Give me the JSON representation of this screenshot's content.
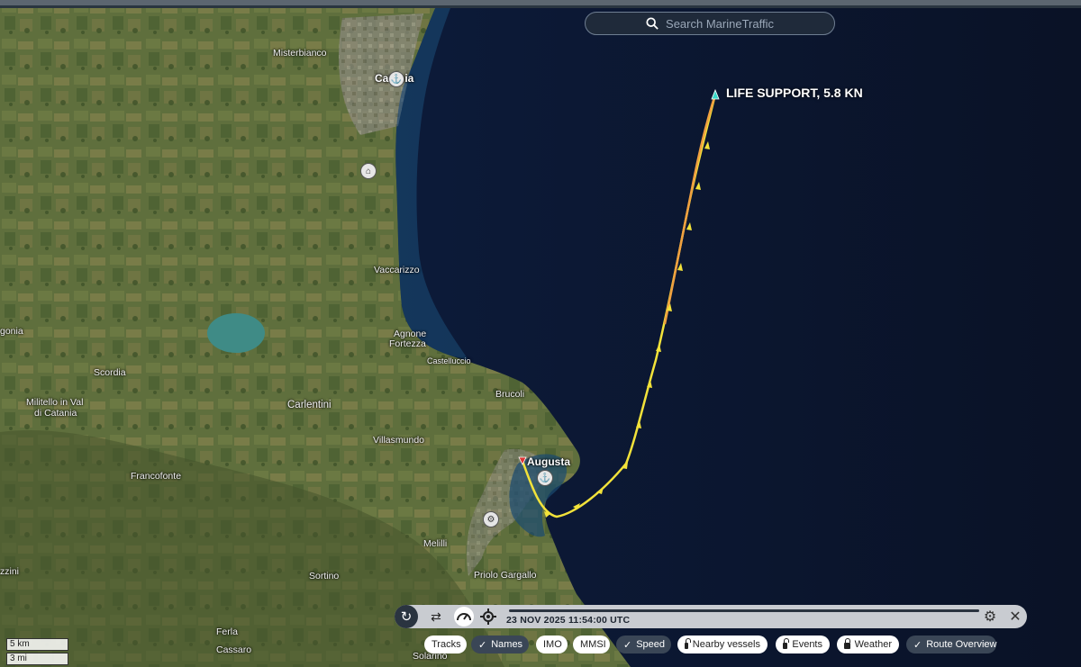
{
  "search": {
    "placeholder": "Search MarineTraffic"
  },
  "vessel": {
    "label": "LIFE SUPPORT, 5.8 KN"
  },
  "places": {
    "misterbianco": "Misterbianco",
    "catania": "Catania",
    "vaccarizzo": "Vaccarizzo",
    "agnone": "Agnone",
    "fortezza": "Fortezza",
    "castelluccio": "Castelluccio",
    "brucoli": "Brucoli",
    "augusta": "Augusta",
    "carlentini": "Carlentini",
    "villasmundo": "Villasmundo",
    "scordia": "Scordia",
    "militello1": "Militello in Val",
    "militello2": "di Catania",
    "francofonte": "Francofonte",
    "melilli": "Melilli",
    "sortino": "Sortino",
    "priolo": "Priolo Gargallo",
    "ferla": "Ferla",
    "cassaro": "Cassaro",
    "solarino": "Solarino",
    "agonia": "gonia",
    "zzini": "zzini"
  },
  "playback": {
    "timestamp": "23 NOV 2025 11:54:00 UTC",
    "progress": 1.0
  },
  "toggles": [
    {
      "label": "Tracks",
      "state": "off",
      "icon": "none"
    },
    {
      "label": "Names",
      "state": "on",
      "icon": "check"
    },
    {
      "label": "IMO",
      "state": "off",
      "icon": "none"
    },
    {
      "label": "MMSI",
      "state": "off",
      "icon": "none"
    },
    {
      "label": "Speed",
      "state": "on",
      "icon": "check"
    },
    {
      "label": "Nearby vessels",
      "state": "off",
      "icon": "lock"
    },
    {
      "label": "Events",
      "state": "off",
      "icon": "lock"
    },
    {
      "label": "Weather",
      "state": "off",
      "icon": "lock"
    },
    {
      "label": "Route Overview",
      "state": "on",
      "icon": "check"
    }
  ],
  "scale": {
    "metric": "5 km",
    "imperial": "3 mi"
  },
  "colors": {
    "sea": "#0b1530",
    "land": "#5a6b3c",
    "track": "#f2e23a",
    "track_fast": "#f0a040",
    "vessel": "#39d8c8"
  }
}
